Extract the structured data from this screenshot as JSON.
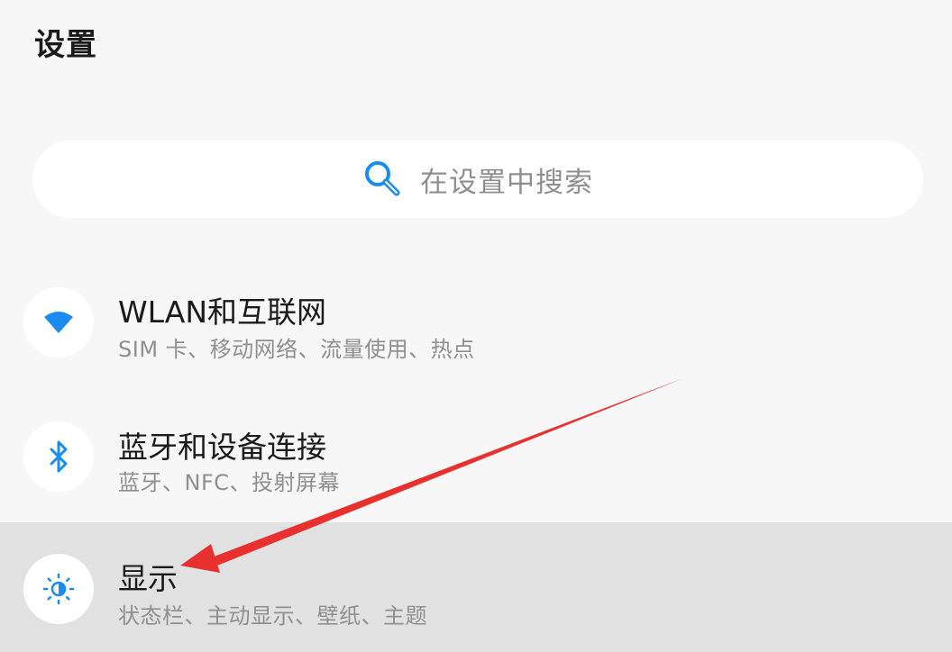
{
  "header": {
    "title": "设置"
  },
  "search": {
    "placeholder": "在设置中搜索",
    "icon": "search-icon"
  },
  "settings_items": [
    {
      "title": "WLAN和互联网",
      "subtitle": "SIM 卡、移动网络、流量使用、热点",
      "icon": "wifi-icon",
      "highlighted": false
    },
    {
      "title": "蓝牙和设备连接",
      "subtitle": "蓝牙、NFC、投射屏幕",
      "icon": "bluetooth-icon",
      "highlighted": false
    },
    {
      "title": "显示",
      "subtitle": "状态栏、主动显示、壁纸、主题",
      "icon": "brightness-icon",
      "highlighted": true
    }
  ],
  "colors": {
    "accent": "#1a8cf0",
    "background": "#f7f7f7",
    "highlight": "#e1e1e1",
    "annotation": "#e8312f"
  }
}
